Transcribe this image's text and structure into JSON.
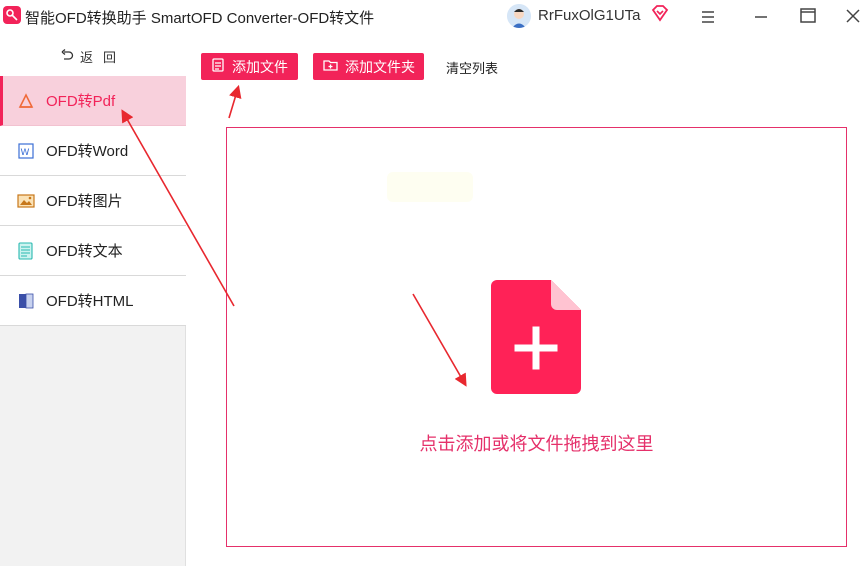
{
  "window": {
    "title": "智能OFD转换助手 SmartOFD Converter-OFD转文件",
    "user_name": "RrFuxOlG1UTa"
  },
  "sidebar": {
    "back_label": "返回",
    "items": [
      {
        "label": "OFD转Pdf",
        "icon": "pdf-icon",
        "active": true
      },
      {
        "label": "OFD转Word",
        "icon": "word-icon",
        "active": false
      },
      {
        "label": "OFD转图片",
        "icon": "image-icon",
        "active": false
      },
      {
        "label": "OFD转文本",
        "icon": "text-icon",
        "active": false
      },
      {
        "label": "OFD转HTML",
        "icon": "html-icon",
        "active": false
      }
    ]
  },
  "toolbar": {
    "add_file_label": "添加文件",
    "add_folder_label": "添加文件夹",
    "clear_label": "清空列表"
  },
  "dropzone": {
    "hint": "点击添加或将文件拖拽到这里"
  },
  "colors": {
    "accent": "#f22359",
    "active_bg": "#f8d0dc",
    "sidebar_bg": "#f2f2f2"
  }
}
